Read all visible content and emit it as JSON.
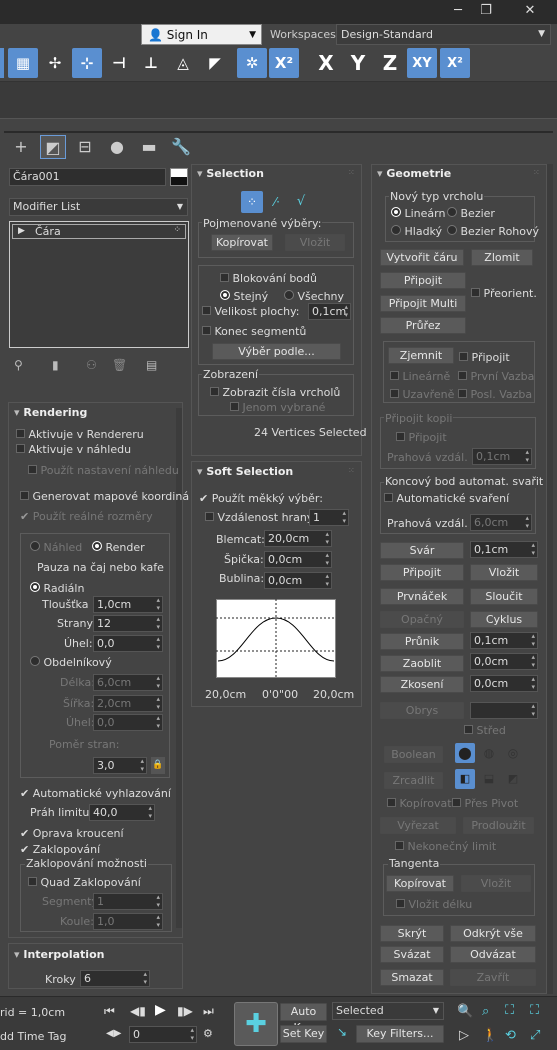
{
  "window": {
    "min": "─",
    "restore": "❐",
    "close": "✕"
  },
  "header": {
    "sign_in": "Sign In",
    "workspaces_label": "Workspaces:",
    "workspace": "Design-Standard"
  },
  "toolbar": {
    "axes": [
      "X",
      "Y",
      "Z",
      "XY",
      "X²"
    ]
  },
  "object": {
    "name": "Čára001",
    "modifier_list": "Modifier List",
    "stack_item": "Čára"
  },
  "rendering": {
    "title": "Rendering",
    "renderer": "Aktivuje v Rendereru",
    "viewport": "Aktivuje v náhledu",
    "use_viewport": "Použít nastavení náhledu",
    "gen_mapping": "Generovat mapové koordiná",
    "real_world": "Použít reálné rozměry",
    "preview": "Náhled",
    "render": "Render",
    "pause": "Pauza na čaj nebo kafe",
    "radial": "Radiáln",
    "thickness": "Tloušťka",
    "thickness_val": "1,0cm",
    "sides": "Strany",
    "sides_val": "12",
    "angle": "Úhel:",
    "angle_val": "0,0",
    "rect": "Obdelníkový",
    "length": "Délka:",
    "length_val": "6,0cm",
    "width": "Šířka:",
    "width_val": "2,0cm",
    "angle2": "Úhel:",
    "angle2_val": "0,0",
    "aspect": "Poměr stran:",
    "aspect_val": "3,0",
    "auto_smooth": "Automatické vyhlazování",
    "threshold": "Práh limitu:",
    "threshold_val": "40,0",
    "twist": "Oprava kroucení",
    "cap": "Zaklopování",
    "cap_options": "Zaklopování možnosti",
    "quad_cap": "Quad Zaklopování",
    "segments": "Segmenty",
    "segments_val": "1",
    "corners": "Koule:",
    "corners_val": "1,0"
  },
  "interpolation": {
    "title": "Interpolation",
    "steps": "Kroky",
    "steps_val": "6"
  },
  "selection": {
    "title": "Selection",
    "named": "Pojmenované výběry:",
    "copy": "Kopírovat",
    "paste": "Vložit",
    "lock_handles": "Blokování bodů",
    "alike": "Stejný",
    "all": "Všechny",
    "area": "Velikost plochy:",
    "area_val": "0,1cm",
    "seg_end": "Konec segmentů",
    "select_by": "Výběr podle...",
    "display": "Zobrazení",
    "show_nums": "Zobrazit čísla vrcholů",
    "selected_only": "Jenom vybrané",
    "vertices": "24 Vertices Selected"
  },
  "soft": {
    "title": "Soft Selection",
    "use": "Použít měkký výběr:",
    "edge_dist": "Vzdálenost hrany",
    "edge_val": "1",
    "falloff": "Blemcat:",
    "falloff_val": "20,0cm",
    "pinch": "Špička:",
    "pinch_val": "0,0cm",
    "bubble": "Bublina:",
    "bubble_val": "0,0cm",
    "left": "20,0cm",
    "center": "0'0\"00",
    "right": "20,0cm"
  },
  "geometry": {
    "title": "Geometrie",
    "new_vertex": "Nový typ vrcholu",
    "linear": "Lineárn",
    "bezier": "Bezier",
    "smooth": "Hladký",
    "bezier_corner": "Bezier Rohový",
    "create_line": "Vytvořit čáru",
    "break": "Zlomit",
    "attach": "Připojit",
    "attach_multi": "Připojit Multi",
    "reorient": "Přeorient.",
    "cross": "Průřez",
    "refine": "Zjemnit",
    "connect": "Připojit",
    "linear2": "Lineárně",
    "first_v": "První Vazba",
    "closed": "Uzavřeně",
    "last_v": "Posl. Vazba",
    "connect_copy": "Připojit kopii",
    "connect2": "Připojit",
    "thresh": "Prahová vzdál.",
    "thresh_val": "0,1cm",
    "end_weld": "Koncový bod automat. svařit",
    "auto_weld": "Automatické svaření",
    "thresh2": "Prahová vzdál.",
    "thresh2_val": "6,0cm",
    "weld": "Svár",
    "weld_val": "0,1cm",
    "connect3": "Připojit",
    "insert": "Vložit",
    "make_first": "Prvnáček",
    "fuse": "Sloučit",
    "reverse": "Opačný",
    "cycle": "Cyklus",
    "crossins": "Průnik",
    "crossins_val": "0,1cm",
    "fillet": "Zaoblit",
    "fillet_val": "0,0cm",
    "chamfer": "Zkosení",
    "chamfer_val": "0,0cm",
    "outline": "Obrys",
    "center": "Střed",
    "boolean": "Boolean",
    "mirror": "Zrcadlit",
    "copy": "Kopírovat",
    "about_pivot": "Přes Pivot",
    "trim": "Vyřezat",
    "extend": "Prodloužit",
    "infinite": "Nekonečný limit",
    "tangent": "Tangenta",
    "t_copy": "Kopírovat",
    "t_paste": "Vložit",
    "paste_len": "Vložit délku",
    "hide": "Skrýt",
    "unhide": "Odkrýt vše",
    "bind": "Svázat",
    "unbind": "Odvázat",
    "delete": "Smazat",
    "close": "Zavřít"
  },
  "status": {
    "grid": "rid = 1,0cm",
    "add_time": "dd Time Tag",
    "auto_key": "Auto Key",
    "set_key": "Set Key",
    "selected": "Selected",
    "key_filters": "Key Filters...",
    "frame": "0"
  },
  "colors": {
    "accent": "#5a8fd0",
    "panel": "#444444",
    "field": "#2e2e2e"
  }
}
